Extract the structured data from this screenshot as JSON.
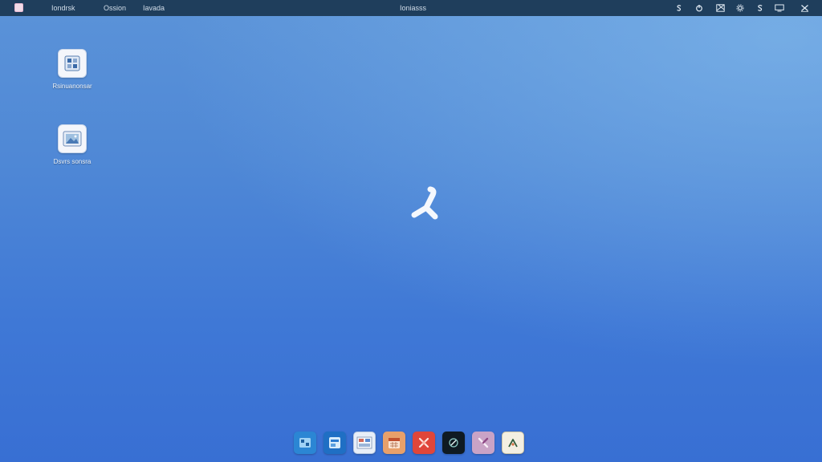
{
  "menubar": {
    "logo": "app-logo",
    "menus": [
      {
        "label": "Iondrsk"
      },
      {
        "label": "Ossion"
      },
      {
        "label": "Iavada"
      }
    ],
    "title": "Ioniasss",
    "status_icons": [
      "s-icon",
      "power-icon",
      "grid-icon",
      "gear-icon",
      "display-icon",
      "close-icon"
    ]
  },
  "desktop": {
    "icons": [
      {
        "label": "Rsinuanonsar",
        "icon": "document-icon"
      },
      {
        "label": "Dsvrs sonsra",
        "icon": "photo-icon"
      }
    ],
    "center_mark": "tool-logo-icon"
  },
  "dock": {
    "items": [
      {
        "name": "files",
        "color": "#2b86d4"
      },
      {
        "name": "browser",
        "color": "#1f6fc4"
      },
      {
        "name": "gallery",
        "color": "#e8eef8"
      },
      {
        "name": "calendar",
        "color": "#e8a06a"
      },
      {
        "name": "settings",
        "color": "#e0463a"
      },
      {
        "name": "terminal",
        "color": "#0f1a22"
      },
      {
        "name": "tools",
        "color": "#c9a3c6"
      },
      {
        "name": "editor",
        "color": "#f3efe2"
      }
    ]
  }
}
